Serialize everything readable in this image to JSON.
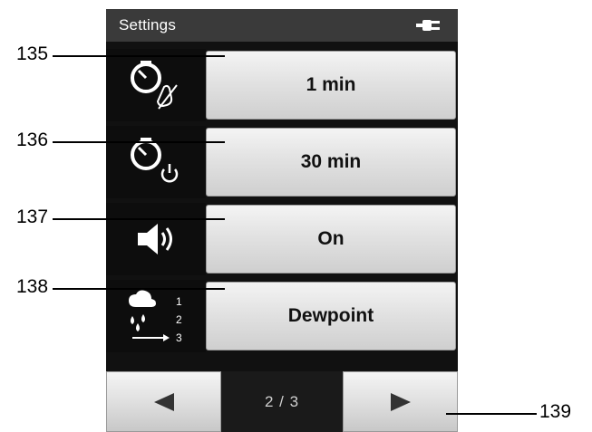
{
  "header": {
    "title": "Settings",
    "power_icon": "plug-icon"
  },
  "settings_rows": [
    {
      "icon": "timer-no-touch-icon",
      "value": "1 min",
      "callout": "135"
    },
    {
      "icon": "timer-power-off-icon",
      "value": "30 min",
      "callout": "136"
    },
    {
      "icon": "speaker-icon",
      "value": "On",
      "callout": "137"
    },
    {
      "icon": "dewpoint-sequence-icon",
      "icon_numbers": [
        "1",
        "2",
        "3"
      ],
      "value": "Dewpoint",
      "callout": "138"
    }
  ],
  "navigation": {
    "prev_icon": "arrow-left-icon",
    "next_icon": "arrow-right-icon",
    "page_indicator": "2 / 3",
    "callout": "139"
  }
}
